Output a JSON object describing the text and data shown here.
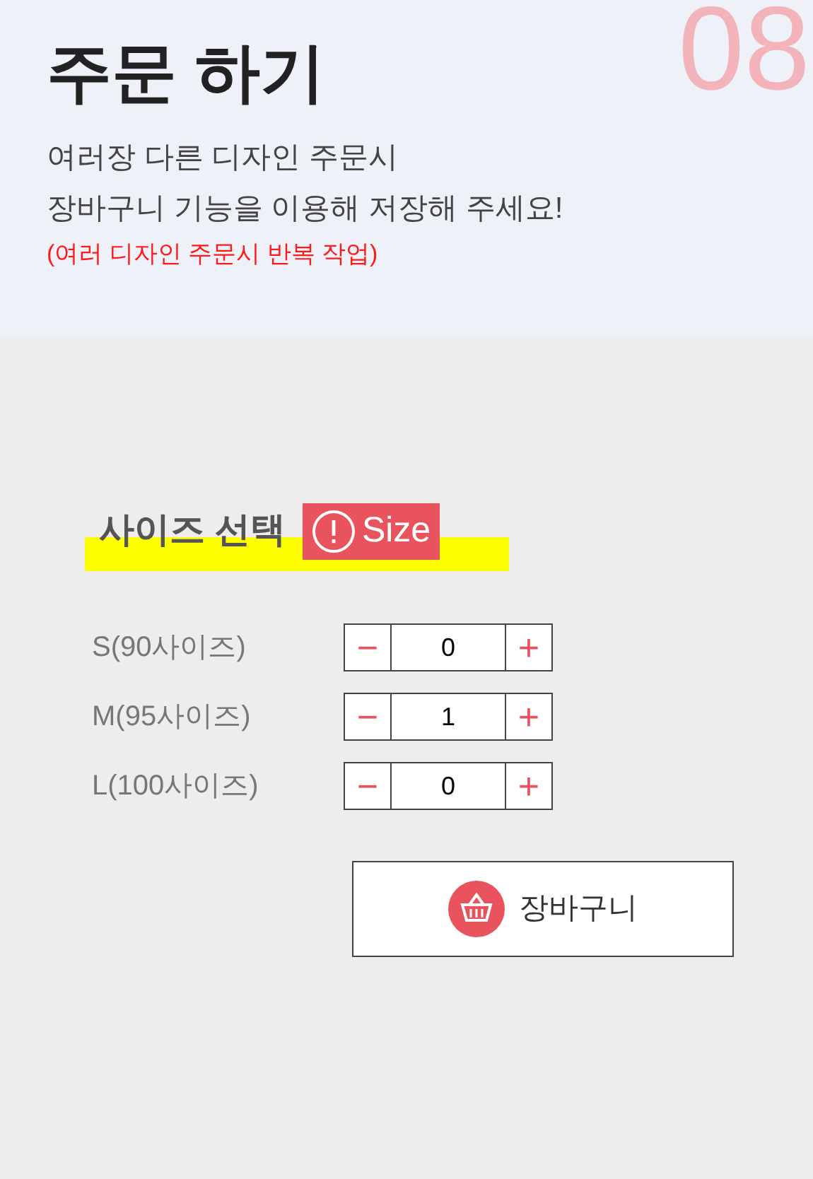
{
  "step_number": "08",
  "title": "주문 하기",
  "description_lines": [
    "여러장 다른 디자인 주문시",
    "장바구니 기능을 이용해 저장해 주세요!"
  ],
  "note": "(여러 디자인 주문시 반복 작업)",
  "size_section": {
    "heading": "사이즈 선택",
    "badge": "Size",
    "rows": [
      {
        "label": "S(90사이즈)",
        "decrement": "−",
        "quantity": "0",
        "increment": "+"
      },
      {
        "label": "M(95사이즈)",
        "decrement": "−",
        "quantity": "1",
        "increment": "+"
      },
      {
        "label": "L(100사이즈)",
        "decrement": "−",
        "quantity": "0",
        "increment": "+"
      }
    ]
  },
  "cart_button": "장바구니"
}
